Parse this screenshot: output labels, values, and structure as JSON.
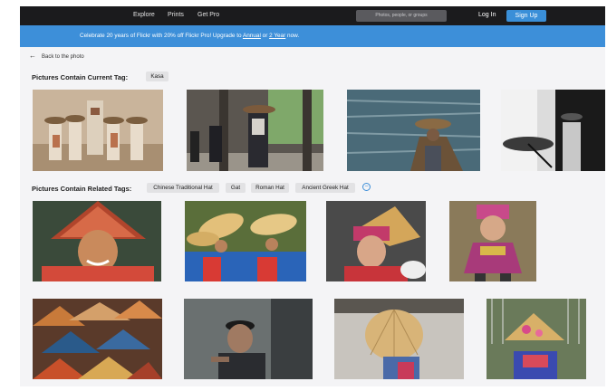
{
  "nav": {
    "explore": "Explore",
    "prints": "Prints",
    "get_pro": "Get Pro",
    "search_placeholder": "Photos, people, or groups",
    "login": "Log In",
    "signup": "Sign Up"
  },
  "banner": {
    "prefix": "Celebrate 20 years of Flickr with 20% off Flickr Pro! Upgrade to ",
    "annual": "Annual",
    "middle": " or ",
    "two_year": "2 Year",
    "suffix": " now."
  },
  "back_link": "Back to the photo",
  "current_tag": {
    "label": "Pictures Contain Current Tag:",
    "tags": [
      "Kasa"
    ]
  },
  "related_tags": {
    "label": "Pictures Contain Related Tags:",
    "tags": [
      "Chinese Traditional Hat",
      "Gat",
      "Roman Hat",
      "Ancient Greek Hat"
    ]
  },
  "icons": {
    "back": "arrow-left-icon",
    "more": "minus-circle-icon"
  },
  "colors": {
    "nav_bg": "#1b1b1d",
    "banner_bg": "#3d8fd9",
    "signup_bg": "#3a8fd8",
    "page_bg": "#f4f4f6",
    "tag_bg": "#e2e2e4"
  }
}
